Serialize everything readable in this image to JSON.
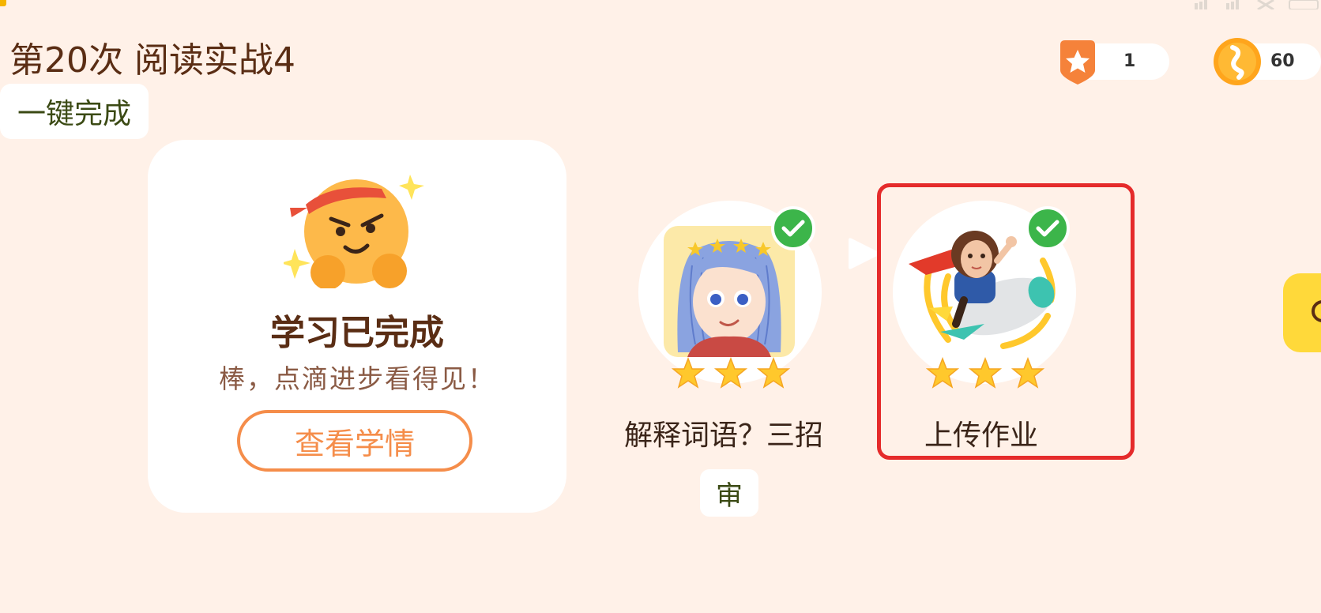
{
  "header": {
    "title": "第20次 阅读实战4",
    "one_click": "一键完成"
  },
  "counters": {
    "stars": "1",
    "coins": "60"
  },
  "completion_card": {
    "title": "学习已完成",
    "subtitle": "棒，点滴进步看得见！",
    "button": "查看学情"
  },
  "steps": [
    {
      "label": "解释词语？三招",
      "stars": 3,
      "completed": true,
      "icon": "girl-avatar-icon"
    },
    {
      "label": "上传作业",
      "stars": 3,
      "completed": true,
      "icon": "rocket-rider-icon"
    }
  ],
  "audit_chip": "审",
  "colors": {
    "background": "#fff1e8",
    "accent_orange": "#f58d4a",
    "title_brown": "#5a2d14",
    "check_green": "#3cb54a",
    "star_yellow": "#ffc82c",
    "highlight_red": "#e52b2b",
    "side_tab_yellow": "#ffd93a"
  }
}
